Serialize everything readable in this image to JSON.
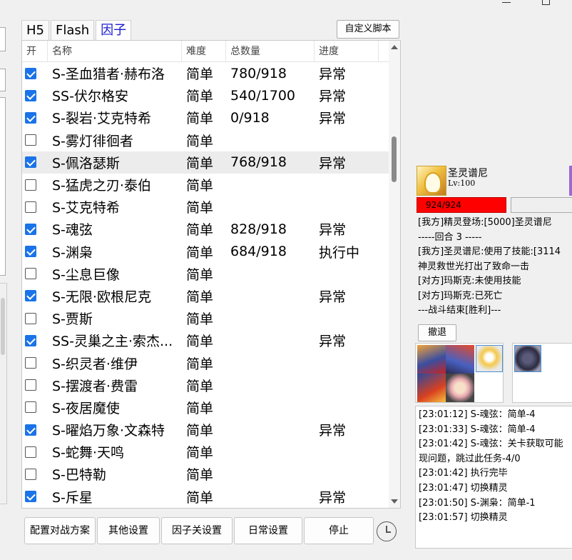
{
  "window": {
    "minimize": "minimize",
    "maximize": "maximize"
  },
  "tabs": [
    {
      "label": "H5"
    },
    {
      "label": "Flash"
    },
    {
      "label": "因子",
      "active": true
    }
  ],
  "custom_script_button": "自定义脚本",
  "table": {
    "headers": {
      "enabled": "开",
      "name": "名称",
      "difficulty": "难度",
      "total": "总数量",
      "progress": "进度"
    },
    "rows": [
      {
        "checked": true,
        "name": "S-圣血猎者·赫布洛",
        "difficulty": "简单",
        "total": "780/918",
        "progress": "异常"
      },
      {
        "checked": true,
        "name": "SS-伏尔格安",
        "difficulty": "简单",
        "total": "540/1700",
        "progress": "异常"
      },
      {
        "checked": true,
        "name": "S-裂岩·艾克特希",
        "difficulty": "简单",
        "total": "0/918",
        "progress": "异常"
      },
      {
        "checked": false,
        "name": "S-雾灯徘徊者",
        "difficulty": "简单",
        "total": "",
        "progress": ""
      },
      {
        "checked": true,
        "name": "S-佩洛瑟斯",
        "difficulty": "简单",
        "total": "768/918",
        "progress": "异常",
        "selected": true
      },
      {
        "checked": false,
        "name": "S-猛虎之刃·泰伯",
        "difficulty": "简单",
        "total": "",
        "progress": ""
      },
      {
        "checked": false,
        "name": "S-艾克特希",
        "difficulty": "简单",
        "total": "",
        "progress": ""
      },
      {
        "checked": true,
        "name": "S-魂弦",
        "difficulty": "简单",
        "total": "828/918",
        "progress": "异常"
      },
      {
        "checked": true,
        "name": "S-渊枭",
        "difficulty": "简单",
        "total": "684/918",
        "progress": "执行中"
      },
      {
        "checked": false,
        "name": "S-尘息巨像",
        "difficulty": "简单",
        "total": "",
        "progress": ""
      },
      {
        "checked": true,
        "name": "S-无限·欧根尼克",
        "difficulty": "简单",
        "total": "",
        "progress": "异常"
      },
      {
        "checked": false,
        "name": "S-贾斯",
        "difficulty": "简单",
        "total": "",
        "progress": ""
      },
      {
        "checked": true,
        "name": "SS-灵巢之主·索杰...",
        "difficulty": "简单",
        "total": "",
        "progress": "异常"
      },
      {
        "checked": false,
        "name": "S-织灵者·维伊",
        "difficulty": "简单",
        "total": "",
        "progress": ""
      },
      {
        "checked": false,
        "name": "S-摆渡者·费雷",
        "difficulty": "简单",
        "total": "",
        "progress": ""
      },
      {
        "checked": false,
        "name": "S-夜居魔使",
        "difficulty": "简单",
        "total": "",
        "progress": ""
      },
      {
        "checked": true,
        "name": "S-曜焰万象·文森特",
        "difficulty": "简单",
        "total": "",
        "progress": "异常"
      },
      {
        "checked": false,
        "name": "S-蛇舞·天鸣",
        "difficulty": "简单",
        "total": "",
        "progress": ""
      },
      {
        "checked": false,
        "name": "S-巴特勒",
        "difficulty": "简单",
        "total": "",
        "progress": ""
      },
      {
        "checked": true,
        "name": "S-斥星",
        "difficulty": "简单",
        "total": "",
        "progress": "异常"
      }
    ]
  },
  "bottom_buttons": [
    {
      "label": "配置对战方案",
      "name": "config-battle-button",
      "width": 100
    },
    {
      "label": "其他设置",
      "name": "other-settings-button",
      "width": 88
    },
    {
      "label": "因子关设置",
      "name": "factor-level-settings-button",
      "width": 100
    },
    {
      "label": "日常设置",
      "name": "daily-settings-button",
      "width": 96
    },
    {
      "label": "停止",
      "name": "stop-button",
      "width": 98
    }
  ],
  "battle": {
    "pet_name": "圣灵谱尼",
    "level": "Lv:100",
    "hp": "924/924",
    "log": [
      "[我方]精灵登场:[5000]圣灵谱尼",
      "-----回合 3 -----",
      "[我方]圣灵谱尼:使用了技能:[3114",
      "神灵救世光打出了致命一击",
      "[对方]玛斯克:未使用技能",
      "[对方]玛斯克:已死亡",
      "---战斗结束[胜利]---"
    ],
    "retreat_button": "撤退"
  },
  "task_log": [
    "[23:01:12] S-魂弦：简单-4",
    "[23:01:33] S-魂弦：简单-4",
    "[23:01:42] S-魂弦：关卡获取可能",
    "现问题，跳过此任务-4/0",
    "[23:01:42]  执行完毕",
    "[23:01:47] 切换精灵",
    "[23:01:50] S-渊枭：简单-1",
    "[23:01:57] 切换精灵"
  ]
}
